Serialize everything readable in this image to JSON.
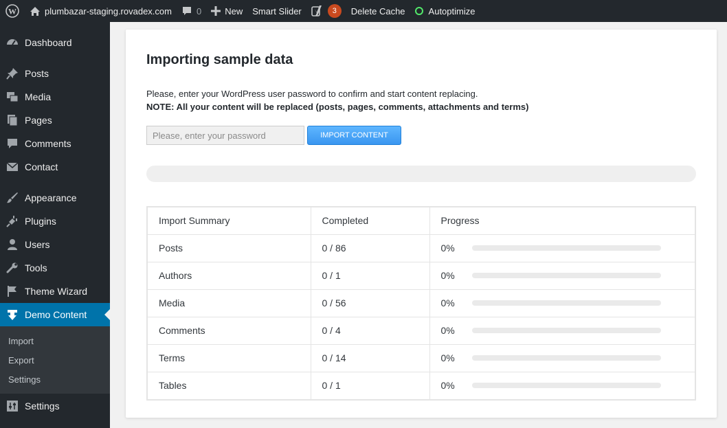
{
  "adminbar": {
    "site": "plumbazar-staging.rovadex.com",
    "comments_count": "0",
    "new_label": "New",
    "smart_slider": "Smart Slider",
    "seo_badge": "3",
    "delete_cache": "Delete Cache",
    "autoptimize": "Autoptimize"
  },
  "sidebar": {
    "items": [
      {
        "label": "Dashboard",
        "icon": "dashboard-icon"
      },
      {
        "label": "Posts",
        "icon": "pin-icon"
      },
      {
        "label": "Media",
        "icon": "media-icon"
      },
      {
        "label": "Pages",
        "icon": "pages-icon"
      },
      {
        "label": "Comments",
        "icon": "comment-icon"
      },
      {
        "label": "Contact",
        "icon": "mail-icon"
      },
      {
        "label": "Appearance",
        "icon": "brush-icon"
      },
      {
        "label": "Plugins",
        "icon": "plug-icon"
      },
      {
        "label": "Users",
        "icon": "user-icon"
      },
      {
        "label": "Tools",
        "icon": "wrench-icon"
      },
      {
        "label": "Theme Wizard",
        "icon": "flag-icon"
      },
      {
        "label": "Demo Content",
        "icon": "download-icon"
      },
      {
        "label": "Settings",
        "icon": "settings-icon"
      }
    ],
    "submenu": [
      "Import",
      "Export",
      "Settings"
    ]
  },
  "panel": {
    "title": "Importing sample data",
    "desc": "Please, enter your WordPress user password to confirm and start content replacing.",
    "note": "NOTE: All your content will be replaced (posts, pages, comments, attachments and terms)",
    "password_placeholder": "Please, enter your password",
    "import_button": "Import content",
    "overall_progress": 0
  },
  "summary": {
    "headers": [
      "Import Summary",
      "Completed",
      "Progress"
    ],
    "rows": [
      {
        "name": "Posts",
        "completed": "0 / 86",
        "percent": "0%",
        "progress": 0
      },
      {
        "name": "Authors",
        "completed": "0 / 1",
        "percent": "0%",
        "progress": 0
      },
      {
        "name": "Media",
        "completed": "0 / 56",
        "percent": "0%",
        "progress": 0
      },
      {
        "name": "Comments",
        "completed": "0 / 4",
        "percent": "0%",
        "progress": 0
      },
      {
        "name": "Terms",
        "completed": "0 / 14",
        "percent": "0%",
        "progress": 0
      },
      {
        "name": "Tables",
        "completed": "0 / 1",
        "percent": "0%",
        "progress": 0
      }
    ]
  },
  "colors": {
    "adminbar_bg": "#23282d",
    "current_menu": "#0073aa",
    "button": "#3a96f0",
    "badge": "#ca4a1f",
    "ok_indicator": "#52e86a"
  }
}
